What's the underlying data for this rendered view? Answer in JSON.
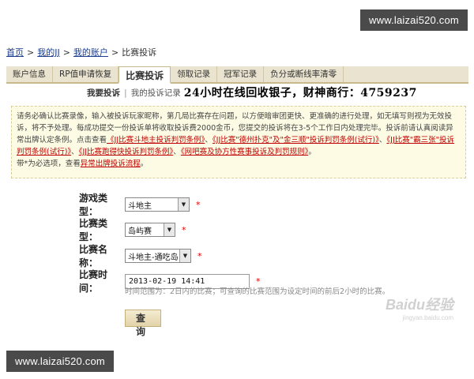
{
  "watermark": {
    "top": "www.laizai520.com",
    "bottom": "www.laizai520.com"
  },
  "breadcrumb": {
    "items": [
      "首页",
      "我的JJ",
      "我的账户"
    ],
    "current": "比赛投诉",
    "separator": ">"
  },
  "tabs": [
    {
      "label": "账户信息"
    },
    {
      "label": "RP值申请恢复"
    },
    {
      "label": "比赛投诉",
      "active": true
    },
    {
      "label": "领取记录"
    },
    {
      "label": "冠军记录"
    },
    {
      "label": "负分或断线率清零"
    }
  ],
  "subnav": {
    "active": "我要投诉",
    "item": "我的投诉记录",
    "separator": "|",
    "banner": "24小时在线回收银子，财神商行：4759237"
  },
  "notice": {
    "text1": "请务必确认比赛录像，输入被投诉玩家昵称，第几局比赛存在问题，以方便暗审团更快、更准确的进行处理，如无填写则视为无效投诉，将不予处理。每成功提交一份投诉单将收取投诉费2000金币，您提交的投诉将在3-5个工作日内处理完毕。投诉前请认真阅读异常出牌认定条例。点击查看",
    "rules": [
      "《JJ比赛斗地主投诉判罚条例》",
      "《JJ比赛\"德州扑克\"及\"金三顺\"投诉判罚条例(试行)》",
      "《JJ比赛\"霸三张\"投诉判罚条例(试行)》",
      "《JJ比赛跑得快投诉判罚条例》",
      "《网吧赛及协方性赛事投诉及判罚规则》"
    ],
    "text2": "带*为必选项，查看",
    "flow_link": "异常出牌投诉流程",
    "end": "。"
  },
  "form": {
    "game_type": {
      "label": "游戏类型：",
      "value": "斗地主"
    },
    "match_type": {
      "label": "比赛类型：",
      "value": "岛屿赛"
    },
    "match_name": {
      "label": "比赛名称：",
      "value": "斗地主-通吃岛"
    },
    "match_time": {
      "label": "比赛时间：",
      "value": "2013-02-19 14:41"
    },
    "required_mark": "*",
    "hint": "时间范围为：2日内的比赛；可查询的比赛范围为设定时间的前后2小时的比赛。",
    "query_label": "查询"
  },
  "logo_watermark": {
    "text": "Baidu经验",
    "sub": "jingyan.baidu.com"
  }
}
